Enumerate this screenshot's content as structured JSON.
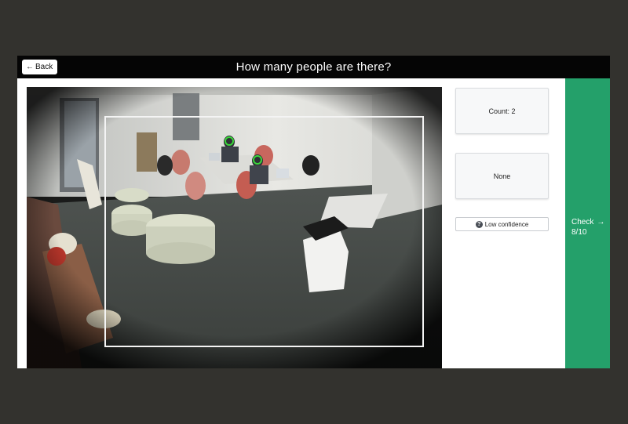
{
  "header": {
    "back_label": "Back",
    "title": "How many people are there?"
  },
  "options": {
    "count_label": "Count: 2",
    "none_label": "None"
  },
  "low_confidence": {
    "label": "Low confidence",
    "icon": "question-circle-icon"
  },
  "check": {
    "label": "Check",
    "progress": "8/10",
    "icon": "arrow-right-icon"
  },
  "colors": {
    "topbar": "#050505",
    "check_panel": "#24a06a",
    "marker": "#3ad63a",
    "background": "#33322e"
  }
}
